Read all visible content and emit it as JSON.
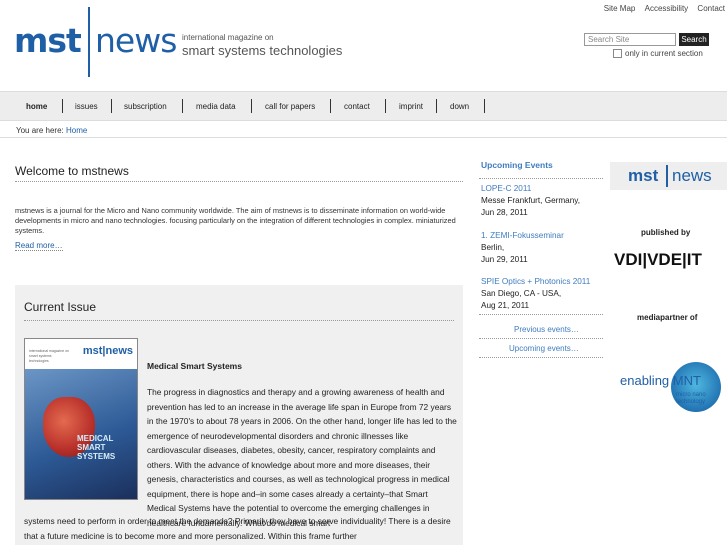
{
  "header": {
    "logo_left": "mst",
    "logo_right": "news",
    "tagline_small": "international magazine on",
    "tagline_large": "smart systems technologies",
    "toplinks": [
      "Site Map",
      "Accessibility",
      "Contact"
    ],
    "search_placeholder": "Search Site",
    "search_button": "Search",
    "only_section_label": "only in current section"
  },
  "nav": {
    "items": [
      "home",
      "issues",
      "subscription",
      "media data",
      "call for papers",
      "contact",
      "imprint",
      "down"
    ],
    "active": "home"
  },
  "breadcrumb": {
    "prefix": "You are here:",
    "current": "Home"
  },
  "welcome": {
    "title": "Welcome to mstnews",
    "text": "mstnews is a journal for the Micro and Nano community worldwide. The aim of mstnews is to disseminate information on world-wide developments in micro and nano technologies. focusing particularly on the integration of different technologies in complex. miniaturized systems.",
    "read_more": "Read more…"
  },
  "current_issue": {
    "title": "Current Issue",
    "cover_brand": "mst|news",
    "cover_tag": "international magazine on smart systems technologies",
    "cover_title": "MEDICAL SMART SYSTEMS",
    "article_title": "Medical Smart Systems",
    "article_body": "The progress in diagnostics and therapy and a growing awareness of health and prevention has led to an increase in the average life span in Europe from 72 years in the 1970's to about 78 years in 2006. On the other hand, longer life has led to the emergence of neurodevelopmental disorders and chronic illnesses like cardiovascular diseases, diabetes, obesity, cancer, respiratory complaints and others. With the advance of knowledge about more and more diseases, their genesis, characteristics and courses, as well as technological progress in medical equipment, there is hope and–in some cases already a certainty–that Smart Medical Systems have the potential to overcome the emerging challenges in healthcare fundamentally. What do medical smart",
    "article_continued": "systems need to perform in order to meet the demands? Primarily they have to serve individuality! There is a desire that a future medicine is to become more and more personalized. Within this frame further"
  },
  "events": {
    "title": "Upcoming Events",
    "items": [
      {
        "name": "LOPE-C 2011",
        "place": "Messe Frankfurt, Germany,",
        "date": "Jun 28, 2011"
      },
      {
        "name": "1. ZEMI-Fokusseminar",
        "place": "Berlin,",
        "date": "Jun 29, 2011"
      },
      {
        "name": "SPIE Optics + Photonics 2011",
        "place": "San Diego, CA - USA,",
        "date": "Aug 21, 2011"
      }
    ],
    "previous": "Previous events…",
    "upcoming": "Upcoming events…"
  },
  "sponsors": {
    "logo_left": "mst",
    "logo_right": "news",
    "published_by": "published by",
    "vdi": "VDI|VDE|IT",
    "mediapartner": "mediapartner of",
    "mnt_text": "enabling MNT",
    "mnt_sub1": "micro nano",
    "mnt_sub2": "technology"
  },
  "colors": {
    "brand_blue": "#1f5fa6",
    "link_blue": "#3f7cbf",
    "nav_bg": "#ededed",
    "panel_bg": "#f0f0f0"
  }
}
